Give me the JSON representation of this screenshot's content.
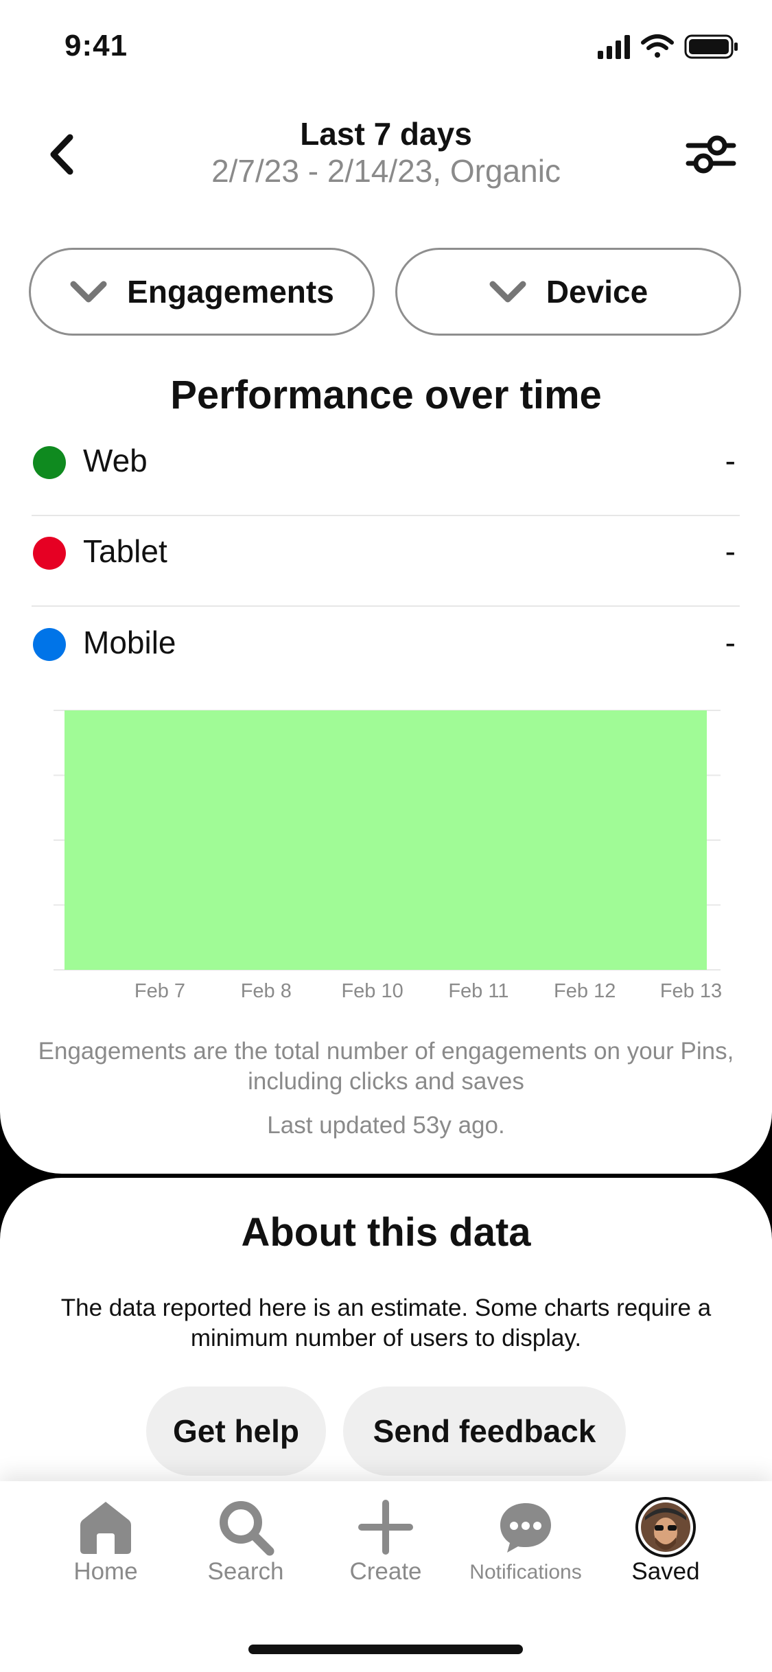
{
  "status_bar": {
    "time": "9:41"
  },
  "header": {
    "title": "Last 7 days",
    "subtitle": "2/7/23 - 2/14/23, Organic"
  },
  "filters": {
    "metric_label": "Engagements",
    "split_label": "Device"
  },
  "section": {
    "title": "Performance over time"
  },
  "legend": [
    {
      "label": "Web",
      "value": "-",
      "color": "#0f8a1f"
    },
    {
      "label": "Tablet",
      "value": "-",
      "color": "#e60023"
    },
    {
      "label": "Mobile",
      "value": "-",
      "color": "#0074e8"
    }
  ],
  "chart_data": {
    "type": "area",
    "categories": [
      "Feb 7",
      "Feb 8",
      "Feb 10",
      "Feb 11",
      "Feb 12",
      "Feb 13"
    ],
    "series": [
      {
        "name": "Web",
        "fill_color": "#a0fb96",
        "fill_level": 1.0
      }
    ],
    "grid": true
  },
  "footnote": "Engagements are the total number of engagements on your Pins, including clicks and saves",
  "last_updated": "Last updated 53y ago.",
  "about": {
    "title": "About this data",
    "body": "The data reported here is an estimate. Some charts require a minimum number of users to display.",
    "help_label": "Get help",
    "feedback_label": "Send feedback"
  },
  "tabbar": [
    {
      "label": "Home",
      "icon": "home-icon"
    },
    {
      "label": "Search",
      "icon": "search-icon"
    },
    {
      "label": "Create",
      "icon": "plus-icon"
    },
    {
      "label": "Notifications",
      "icon": "chat-bubble-icon"
    },
    {
      "label": "Saved",
      "icon": "avatar"
    }
  ]
}
